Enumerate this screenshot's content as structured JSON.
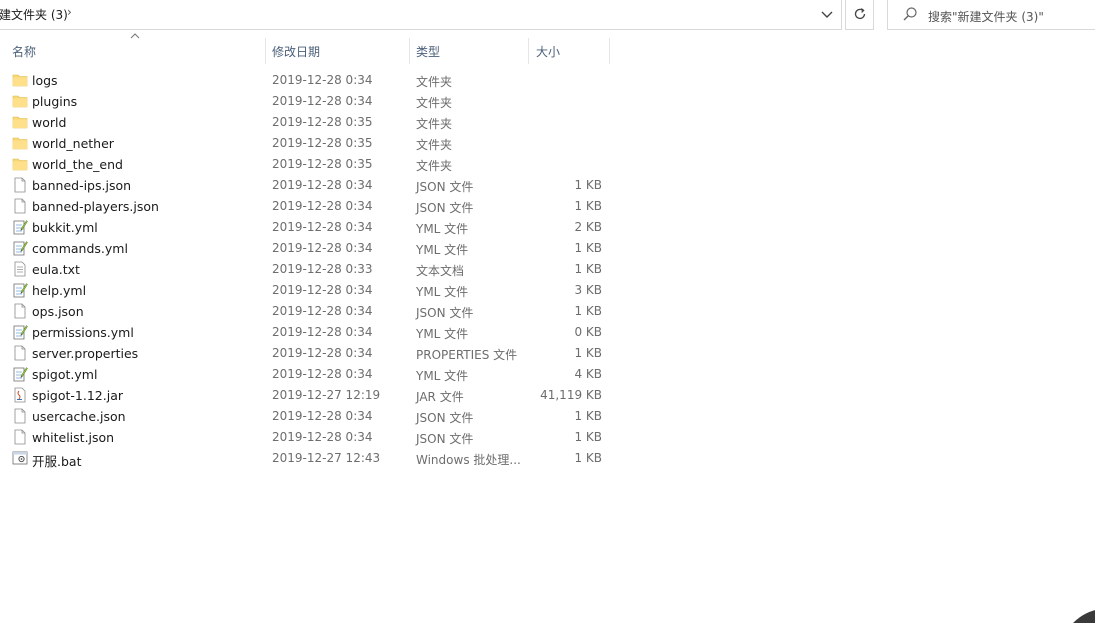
{
  "address_bar": {
    "crumb": "建文件夹 (3)",
    "separator": "›"
  },
  "search": {
    "placeholder": "搜索\"新建文件夹 (3)\""
  },
  "columns": {
    "name": "名称",
    "date": "修改日期",
    "type": "类型",
    "size": "大小"
  },
  "files": [
    {
      "name": "logs",
      "date": "2019-12-28 0:34",
      "type": "文件夹",
      "size": "",
      "icon": "folder-icon"
    },
    {
      "name": "plugins",
      "date": "2019-12-28 0:34",
      "type": "文件夹",
      "size": "",
      "icon": "folder-icon"
    },
    {
      "name": "world",
      "date": "2019-12-28 0:35",
      "type": "文件夹",
      "size": "",
      "icon": "folder-icon"
    },
    {
      "name": "world_nether",
      "date": "2019-12-28 0:35",
      "type": "文件夹",
      "size": "",
      "icon": "folder-icon"
    },
    {
      "name": "world_the_end",
      "date": "2019-12-28 0:35",
      "type": "文件夹",
      "size": "",
      "icon": "folder-icon"
    },
    {
      "name": "banned-ips.json",
      "date": "2019-12-28 0:34",
      "type": "JSON 文件",
      "size": "1 KB",
      "icon": "file-icon"
    },
    {
      "name": "banned-players.json",
      "date": "2019-12-28 0:34",
      "type": "JSON 文件",
      "size": "1 KB",
      "icon": "file-icon"
    },
    {
      "name": "bukkit.yml",
      "date": "2019-12-28 0:34",
      "type": "YML 文件",
      "size": "2 KB",
      "icon": "notepad-file-icon"
    },
    {
      "name": "commands.yml",
      "date": "2019-12-28 0:34",
      "type": "YML 文件",
      "size": "1 KB",
      "icon": "notepad-file-icon"
    },
    {
      "name": "eula.txt",
      "date": "2019-12-28 0:33",
      "type": "文本文档",
      "size": "1 KB",
      "icon": "text-file-icon"
    },
    {
      "name": "help.yml",
      "date": "2019-12-28 0:34",
      "type": "YML 文件",
      "size": "3 KB",
      "icon": "notepad-file-icon"
    },
    {
      "name": "ops.json",
      "date": "2019-12-28 0:34",
      "type": "JSON 文件",
      "size": "1 KB",
      "icon": "file-icon"
    },
    {
      "name": "permissions.yml",
      "date": "2019-12-28 0:34",
      "type": "YML 文件",
      "size": "0 KB",
      "icon": "notepad-file-icon"
    },
    {
      "name": "server.properties",
      "date": "2019-12-28 0:34",
      "type": "PROPERTIES 文件",
      "size": "1 KB",
      "icon": "file-icon"
    },
    {
      "name": "spigot.yml",
      "date": "2019-12-28 0:34",
      "type": "YML 文件",
      "size": "4 KB",
      "icon": "notepad-file-icon"
    },
    {
      "name": "spigot-1.12.jar",
      "date": "2019-12-27 12:19",
      "type": "JAR 文件",
      "size": "41,119 KB",
      "icon": "jar-file-icon"
    },
    {
      "name": "usercache.json",
      "date": "2019-12-28 0:34",
      "type": "JSON 文件",
      "size": "1 KB",
      "icon": "file-icon"
    },
    {
      "name": "whitelist.json",
      "date": "2019-12-28 0:34",
      "type": "JSON 文件",
      "size": "1 KB",
      "icon": "file-icon"
    },
    {
      "name": "开服.bat",
      "date": "2019-12-27 12:43",
      "type": "Windows 批处理...",
      "size": "1 KB",
      "icon": "batch-file-icon"
    }
  ]
}
